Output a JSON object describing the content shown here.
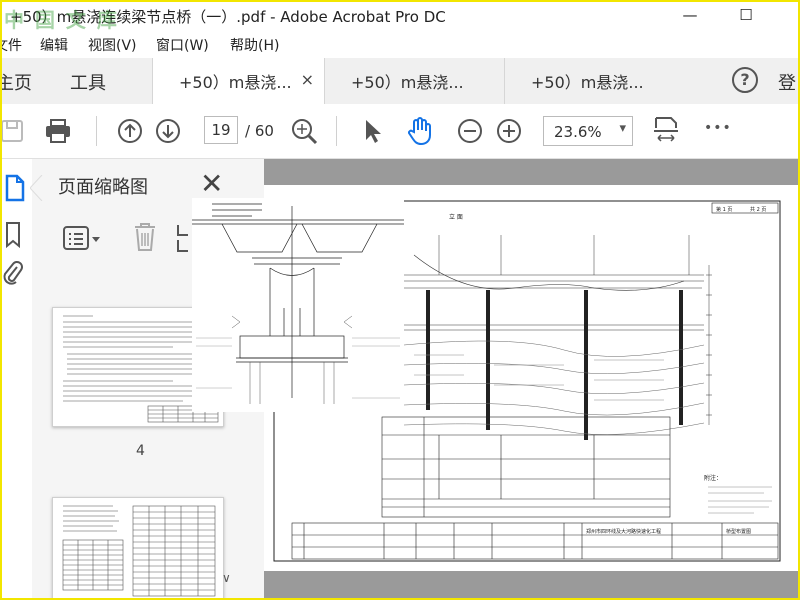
{
  "window": {
    "watermark": "中 国 文 库",
    "title": "+50）m悬浇连续梁节点桥（一）.pdf - Adobe Acrobat Pro DC",
    "minimize_glyph": "—",
    "maximize_glyph": "☐"
  },
  "menu": {
    "items": [
      "文件",
      "编辑",
      "视图(V)",
      "窗口(W)",
      "帮助(H)"
    ]
  },
  "tabs": {
    "home": "主页",
    "tools": "工具",
    "documents": [
      {
        "label": "+50）m悬浇..."
      },
      {
        "label": "+50）m悬浇..."
      },
      {
        "label": "+50）m悬浇..."
      }
    ],
    "close_glyph": "×",
    "help_glyph": "?",
    "login": "登"
  },
  "toolbar": {
    "current_page": "19",
    "total_pages": "/ 60",
    "zoom": "23.6%",
    "zoom_caret": "▾",
    "more_glyph": "•••"
  },
  "thumbnail_panel": {
    "title": "页面缩略图",
    "close_glyph": "✕",
    "thumb_label": "4",
    "scroll_glyph": "∨"
  },
  "document": {
    "elevation_title": "立 面",
    "sheet_no": "第 1 页",
    "sheet_total": "共 2 页",
    "drawing_name": "桥型布置图",
    "project_name": "郑州市四环线及大河路快速化工程",
    "notes_title": "附注："
  },
  "colors": {
    "frame_border": "#f2e600",
    "tab_background": "#f0f0f0",
    "doc_background": "#9a9a9a",
    "icon": "#555555",
    "active_hand": "#1473e6"
  }
}
